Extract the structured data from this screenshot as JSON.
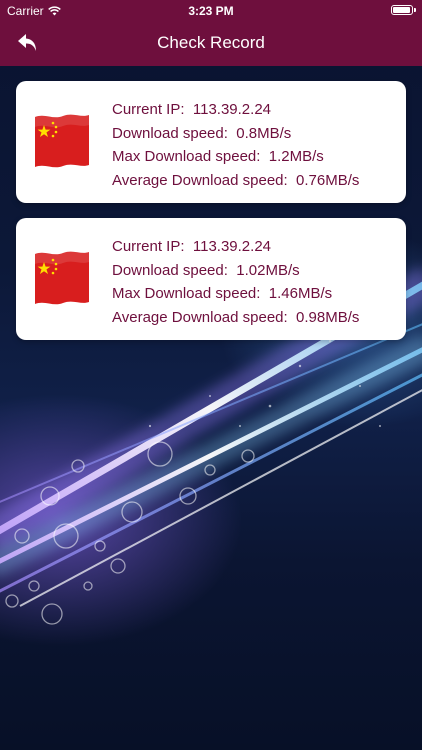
{
  "status_bar": {
    "carrier": "Carrier",
    "time": "3:23 PM"
  },
  "nav": {
    "title": "Check Record",
    "back_icon": "back-arrow-icon"
  },
  "records": [
    {
      "flag_icon": "china-flag-icon",
      "current_ip_label": "Current IP:",
      "current_ip_value": "113.39.2.24",
      "download_label": "Download speed:",
      "download_value": "0.8MB/s",
      "max_label": "Max Download speed:",
      "max_value": "1.2MB/s",
      "avg_label": "Average Download speed:",
      "avg_value": "0.76MB/s"
    },
    {
      "flag_icon": "china-flag-icon",
      "current_ip_label": "Current IP:",
      "current_ip_value": "113.39.2.24",
      "download_label": "Download speed:",
      "download_value": "1.02MB/s",
      "max_label": "Max Download speed:",
      "max_value": "1.46MB/s",
      "avg_label": "Average Download speed:",
      "avg_value": "0.98MB/s"
    }
  ],
  "colors": {
    "nav_background": "#6e0f3d",
    "record_text": "#6e0f3d",
    "card_background": "#ffffff",
    "flag_red": "#d81e1e",
    "flag_star": "#ffde00"
  }
}
